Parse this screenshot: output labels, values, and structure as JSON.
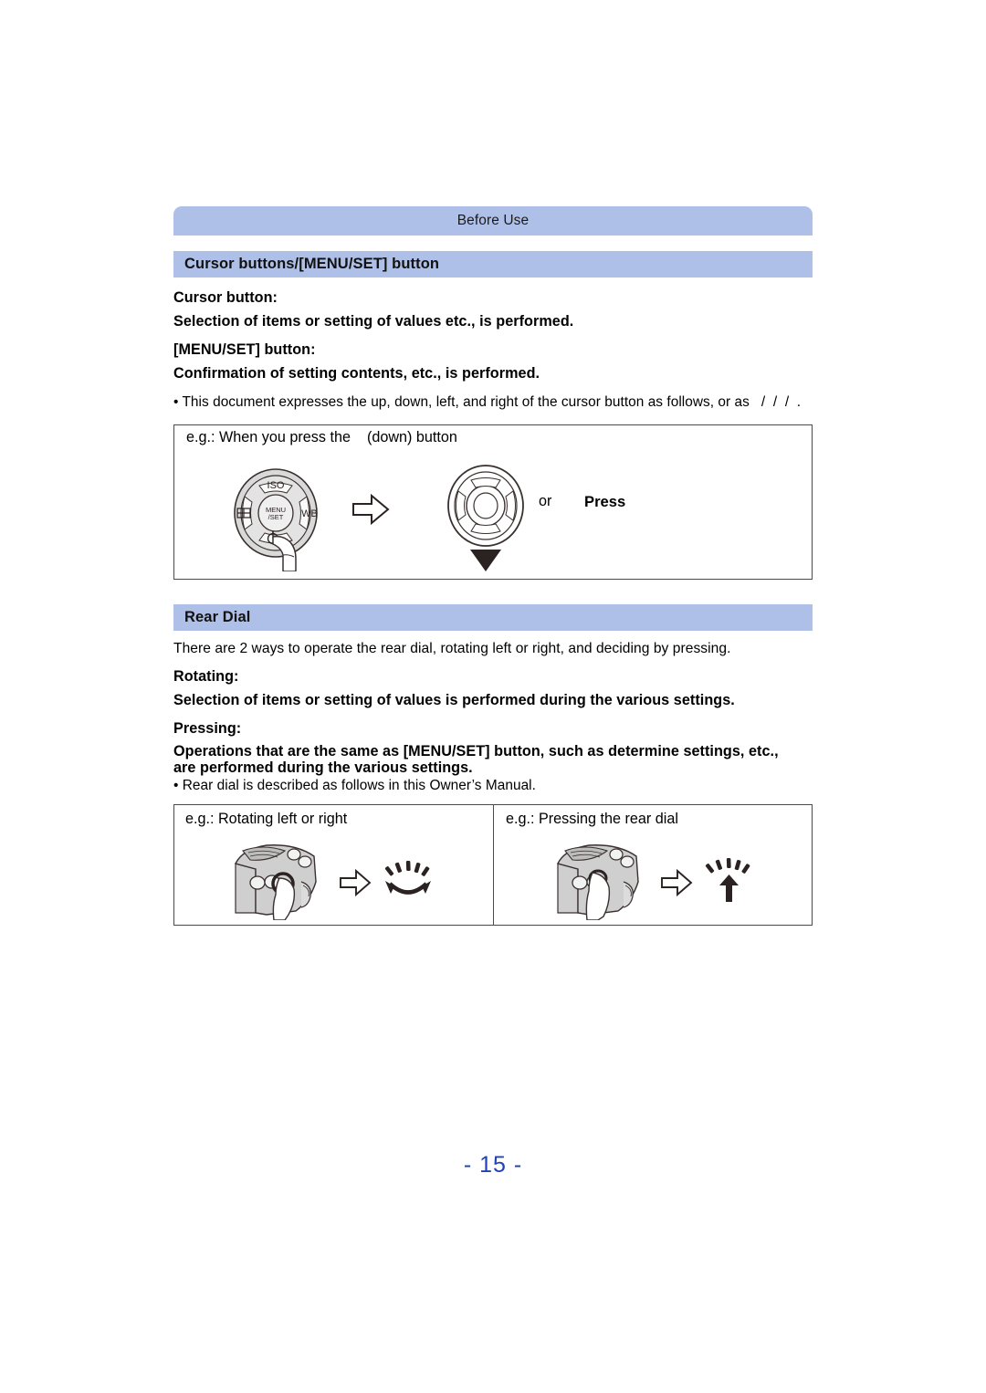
{
  "header": {
    "running_title": "Before Use"
  },
  "sections": [
    {
      "band_title": "Cursor buttons/[MENU/SET] button",
      "cursor_label": "Cursor button:",
      "cursor_desc": "Selection of items or setting of values etc., is performed.",
      "menuset_label": "[MENU/SET] button:",
      "menuset_desc": "Confirmation of setting contents, etc., is performed.",
      "bullet": "• This document expresses the up, down, left, and right of the cursor button as follows, or as   /  /  /  ."
    },
    {
      "band_title": "Rear Dial",
      "intro": "There are 2 ways to operate the rear dial, rotating left or right, and deciding by pressing.",
      "rotating_label": "Rotating:",
      "rotating_desc": "Selection of items or setting of values is performed during the various settings.",
      "pressing_label": "Pressing:",
      "pressing_desc_line1": "Operations that are the same as [MENU/SET] button, such as determine settings, etc.,",
      "pressing_desc_line2": "are performed during the various settings.",
      "bullet": "• Rear dial is described as follows in this Owner’s Manual."
    }
  ],
  "figure_cursor": {
    "caption": "e.g.: When you press the    (down) button",
    "or_text": "or",
    "press_text": "Press",
    "dial_labels": {
      "top": "ISO",
      "right": "WB",
      "center_line1": "MENU",
      "center_line2": "/SET"
    }
  },
  "figure_rear_dial": {
    "panel_left_caption": "e.g.: Rotating left or right",
    "panel_right_caption": "e.g.: Pressing the rear dial"
  },
  "footer": {
    "page_number": "- 15 -"
  },
  "colors": {
    "band_blue": "#afc0e8",
    "page_number_blue": "#1f42b5",
    "box_border": "#4a4a4a",
    "artwork_outline": "#2b2222",
    "artwork_fill": "#d6d6d6"
  }
}
